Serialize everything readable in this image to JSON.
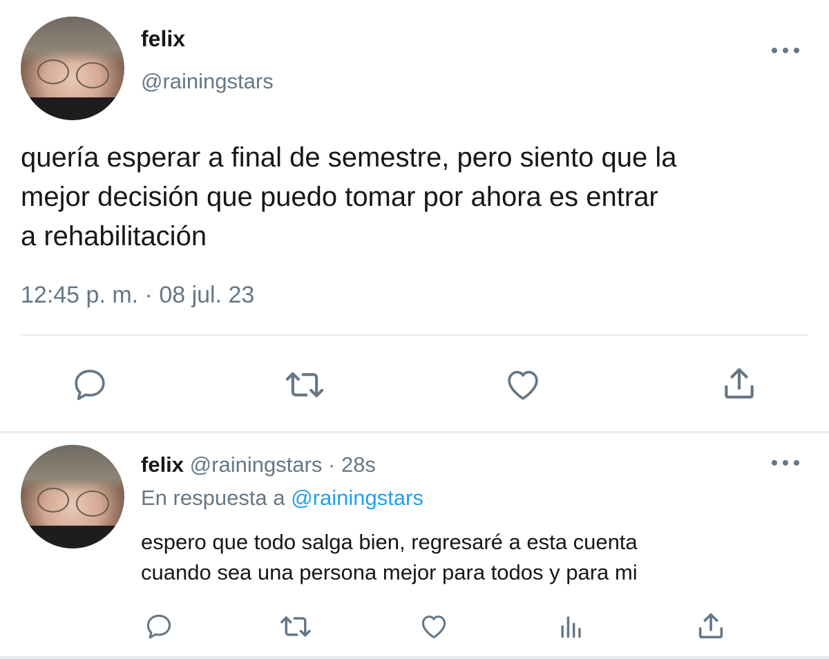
{
  "main_tweet": {
    "author_name": "felix",
    "author_handle": "@rainingstars",
    "text": "quería esperar a final de semestre, pero siento que la\nmejor decisión que puedo tomar por ahora es entrar\na rehabilitación",
    "timestamp": "12:45 p. m. · 08 jul. 23",
    "actions": [
      "reply-icon",
      "retweet-icon",
      "like-icon",
      "share-icon"
    ]
  },
  "reply_tweet": {
    "author_name": "felix",
    "author_handle": "@rainingstars",
    "separator": "·",
    "age": "28s",
    "reply_prefix": "En respuesta a",
    "reply_to_handle": "@rainingstars",
    "text": "espero que todo salga bien, regresaré a esta cuenta\ncuando sea una persona mejor para todos y para mi",
    "actions": [
      "reply-icon",
      "retweet-icon",
      "like-icon",
      "stats-icon",
      "share-icon"
    ]
  },
  "colors": {
    "text_primary": "#14171a",
    "text_secondary": "#657786",
    "link": "#1da1f2",
    "divider": "#e6ecf0"
  }
}
